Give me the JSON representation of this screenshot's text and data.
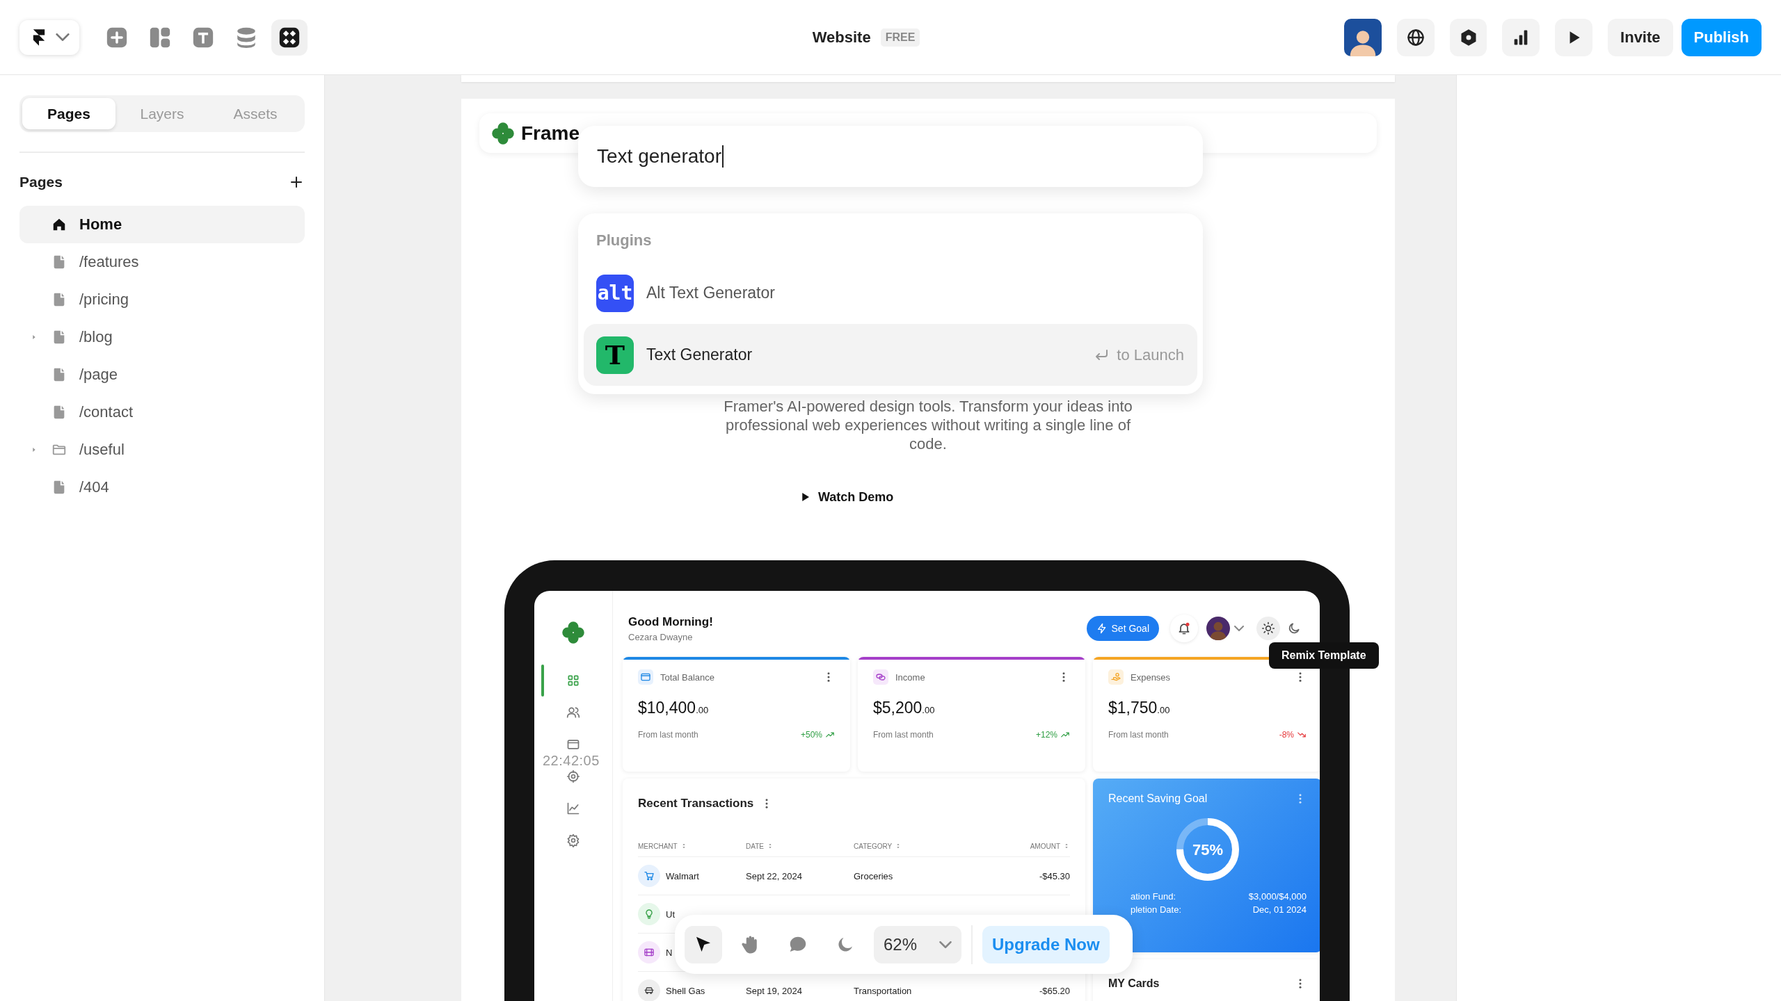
{
  "toolbar": {
    "tools": [
      {
        "kind": "insert",
        "selected": false
      },
      {
        "kind": "layout",
        "selected": false
      },
      {
        "kind": "text",
        "selected": false
      },
      {
        "kind": "cms",
        "selected": false
      },
      {
        "kind": "plugins",
        "selected": true
      }
    ]
  },
  "document": {
    "title": "Website",
    "plan": "FREE"
  },
  "share": {
    "invite": "Invite",
    "publish": "Publish"
  },
  "sidebar": {
    "tabs": [
      {
        "label": "Pages",
        "selected": true
      },
      {
        "label": "Layers",
        "selected": false
      },
      {
        "label": "Assets",
        "selected": false
      }
    ],
    "section": "Pages",
    "pages": [
      {
        "label": "Home",
        "kind": "home",
        "selected": true,
        "has_children": false
      },
      {
        "label": "/features",
        "kind": "page",
        "selected": false,
        "has_children": false
      },
      {
        "label": "/pricing",
        "kind": "page",
        "selected": false,
        "has_children": false
      },
      {
        "label": "/blog",
        "kind": "page",
        "selected": false,
        "has_children": true
      },
      {
        "label": "/page",
        "kind": "page",
        "selected": false,
        "has_children": false
      },
      {
        "label": "/contact",
        "kind": "page",
        "selected": false,
        "has_children": false
      },
      {
        "label": "/useful",
        "kind": "folder",
        "selected": false,
        "has_children": true
      },
      {
        "label": "/404",
        "kind": "page",
        "selected": false,
        "has_children": false
      }
    ]
  },
  "canvas": {
    "site": {
      "logo": "Frame",
      "description": "Framer's AI-powered design tools. Transform your ideas into professional web experiences without writing a single line of code.",
      "cta": "Watch Demo"
    },
    "dashboard": {
      "greeting": "Good Morning!",
      "user": "Cezara Dwayne",
      "set_goal": "Set Goal",
      "nav": [
        {
          "kind": "grid",
          "selected": true
        },
        {
          "kind": "users",
          "selected": false
        },
        {
          "kind": "wallet",
          "selected": false
        },
        {
          "kind": "target",
          "selected": false
        },
        {
          "kind": "chart",
          "selected": false
        },
        {
          "kind": "settings",
          "selected": false
        }
      ],
      "stats": [
        {
          "title": "Total Balance",
          "kind": "wallet",
          "amount": "$10,400",
          "cents": ".00",
          "note": "From last month",
          "change": "+50%",
          "rising": true,
          "color": "#1e88e5"
        },
        {
          "title": "Income",
          "kind": "coins",
          "amount": "$5,200",
          "cents": ".00",
          "note": "From last month",
          "change": "+12%",
          "rising": true,
          "color": "#a53fc9"
        },
        {
          "title": "Expenses",
          "kind": "hand",
          "amount": "$1,750",
          "cents": ".00",
          "note": "From last month",
          "change": "-8%",
          "rising": false,
          "color": "#f5a524"
        }
      ],
      "transactions": {
        "title": "Recent Transactions",
        "columns": [
          "MERCHANT",
          "DATE",
          "CATEGORY",
          "AMOUNT"
        ],
        "rows": [
          {
            "kind": "cart",
            "merchant": "Walmart",
            "date": "Sept 22, 2024",
            "category": "Groceries",
            "amount": "-$45.30"
          },
          {
            "kind": "bulb",
            "merchant": "Ut"
          },
          {
            "kind": "film",
            "merchant": "N"
          },
          {
            "kind": "car",
            "merchant": "Shell Gas",
            "date": "Sept 19, 2024",
            "category": "Transportation",
            "amount": "-$65.20"
          }
        ]
      },
      "saving_goal": {
        "title": "Recent Saving Goal",
        "level": 0.75,
        "percent": "75%",
        "details": [
          {
            "label": "ation Fund:",
            "value": "$3,000/$4,000"
          },
          {
            "label": "pletion Date:",
            "value": "Dec, 01 2024"
          }
        ]
      },
      "cards_title": "MY Cards"
    },
    "tooltip": "Remix Template",
    "clock": "22:42:05"
  },
  "command_palette": {
    "query": "Text generator",
    "section": "Plugins",
    "results": [
      {
        "label": "Alt Text Generator",
        "kind": "alt",
        "icon_text": "alt",
        "selected": false
      },
      {
        "label": "Text Generator",
        "kind": "text",
        "icon_text": "T",
        "selected": true,
        "hint": "to Launch"
      }
    ]
  },
  "canvas_toolbar": {
    "tools": [
      {
        "kind": "pointer",
        "selected": true
      },
      {
        "kind": "hand",
        "selected": false
      },
      {
        "kind": "comment",
        "selected": false
      },
      {
        "kind": "theme",
        "selected": false
      }
    ],
    "zoom": "62%",
    "upgrade": "Upgrade Now"
  }
}
